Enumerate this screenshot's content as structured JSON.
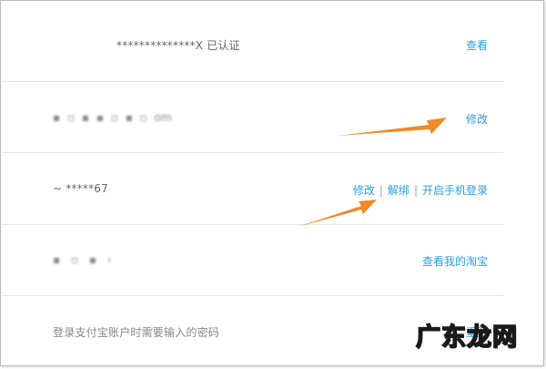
{
  "rows": [
    {
      "text": "**************X 已认证",
      "action": "查看"
    },
    {
      "text": "[blurred email] .com",
      "action": "修改"
    },
    {
      "text": "~ *****67",
      "actions": [
        "修改",
        "解绑",
        "开启手机登录"
      ]
    },
    {
      "text": "[blurred name]",
      "action": "查看我的淘宝"
    },
    {
      "text": "登录支付宝账户时需要输入的密码",
      "action": "重置"
    }
  ],
  "separator": "|",
  "watermark": "广东龙网",
  "colors": {
    "link": "#2a9ee0",
    "arrow": "#f08a24",
    "divider": "#e6e6e6",
    "text": "#666666"
  }
}
